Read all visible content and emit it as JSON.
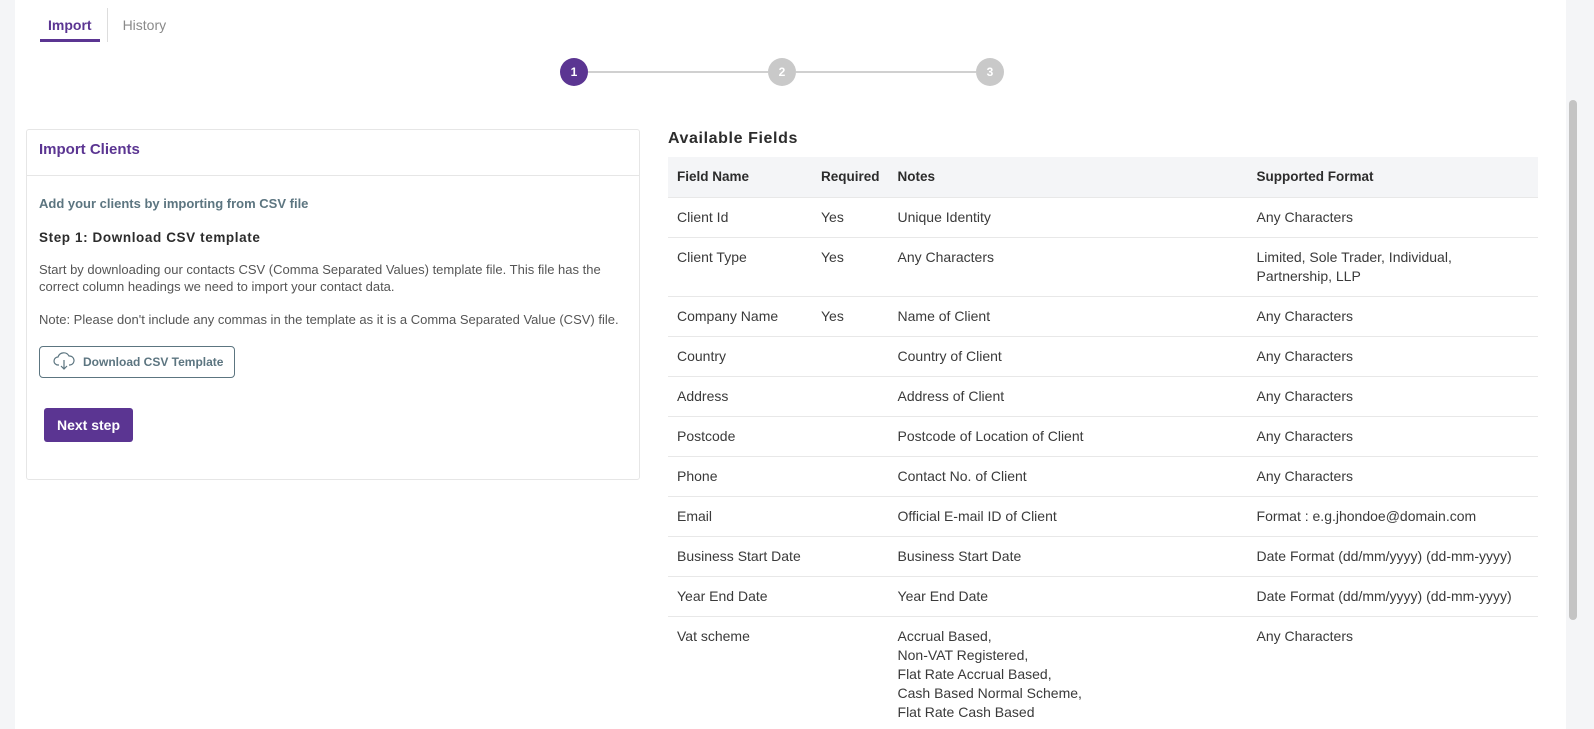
{
  "tabs": [
    {
      "label": "Import",
      "active": true
    },
    {
      "label": "History",
      "active": false
    }
  ],
  "stepper": {
    "steps": [
      "1",
      "2",
      "3"
    ],
    "current": 1,
    "active_color": "#5b3592",
    "inactive_color": "#c9c9c9"
  },
  "import_card": {
    "title": "Import Clients",
    "subtitle": "Add your clients by importing from CSV file",
    "step_heading": "Step 1: Download CSV template",
    "description": "Start by downloading our contacts CSV (Comma Separated Values) template file. This file has the correct column headings we need to import your contact data.",
    "note": "Note: Please don't include any commas in the template as it is a Comma Separated Value (CSV) file.",
    "download_label": "Download CSV Template",
    "next_label": "Next step"
  },
  "available_fields": {
    "title": "Available Fields",
    "headers": [
      "Field Name",
      "Required",
      "Notes",
      "Supported Format"
    ],
    "rows": [
      [
        "Client Id",
        "Yes",
        "Unique Identity",
        "Any Characters"
      ],
      [
        "Client Type",
        "Yes",
        "Any Characters",
        " Limited, Sole Trader, Individual, Partnership, LLP"
      ],
      [
        "Company Name",
        "Yes",
        " Name of Client",
        "Any Characters"
      ],
      [
        "Country",
        "",
        "Country of Client",
        "Any Characters"
      ],
      [
        "Address",
        "",
        "Address of Client",
        "Any Characters"
      ],
      [
        "Postcode",
        "",
        " Postcode of Location of Client",
        "Any Characters"
      ],
      [
        "Phone",
        "",
        " Contact No. of Client",
        "Any Characters"
      ],
      [
        "Email",
        "",
        "Official E-mail ID of Client",
        "Format : e.g.jhondoe@domain.com"
      ],
      [
        "Business Start Date",
        "",
        " Business Start Date",
        "Date Format (dd/mm/yyyy) (dd-mm-yyyy)"
      ],
      [
        "Year End Date",
        "",
        " Year End Date",
        "Date Format (dd/mm/yyyy) (dd-mm-yyyy)"
      ],
      [
        "Vat scheme",
        "",
        "Accrual Based,\nNon-VAT Registered,\nFlat Rate Accrual Based,\n Cash Based Normal Scheme,\nFlat Rate Cash Based",
        "Any Characters"
      ]
    ]
  },
  "colors": {
    "accent": "#5b3592",
    "muted": "#5c7580"
  }
}
